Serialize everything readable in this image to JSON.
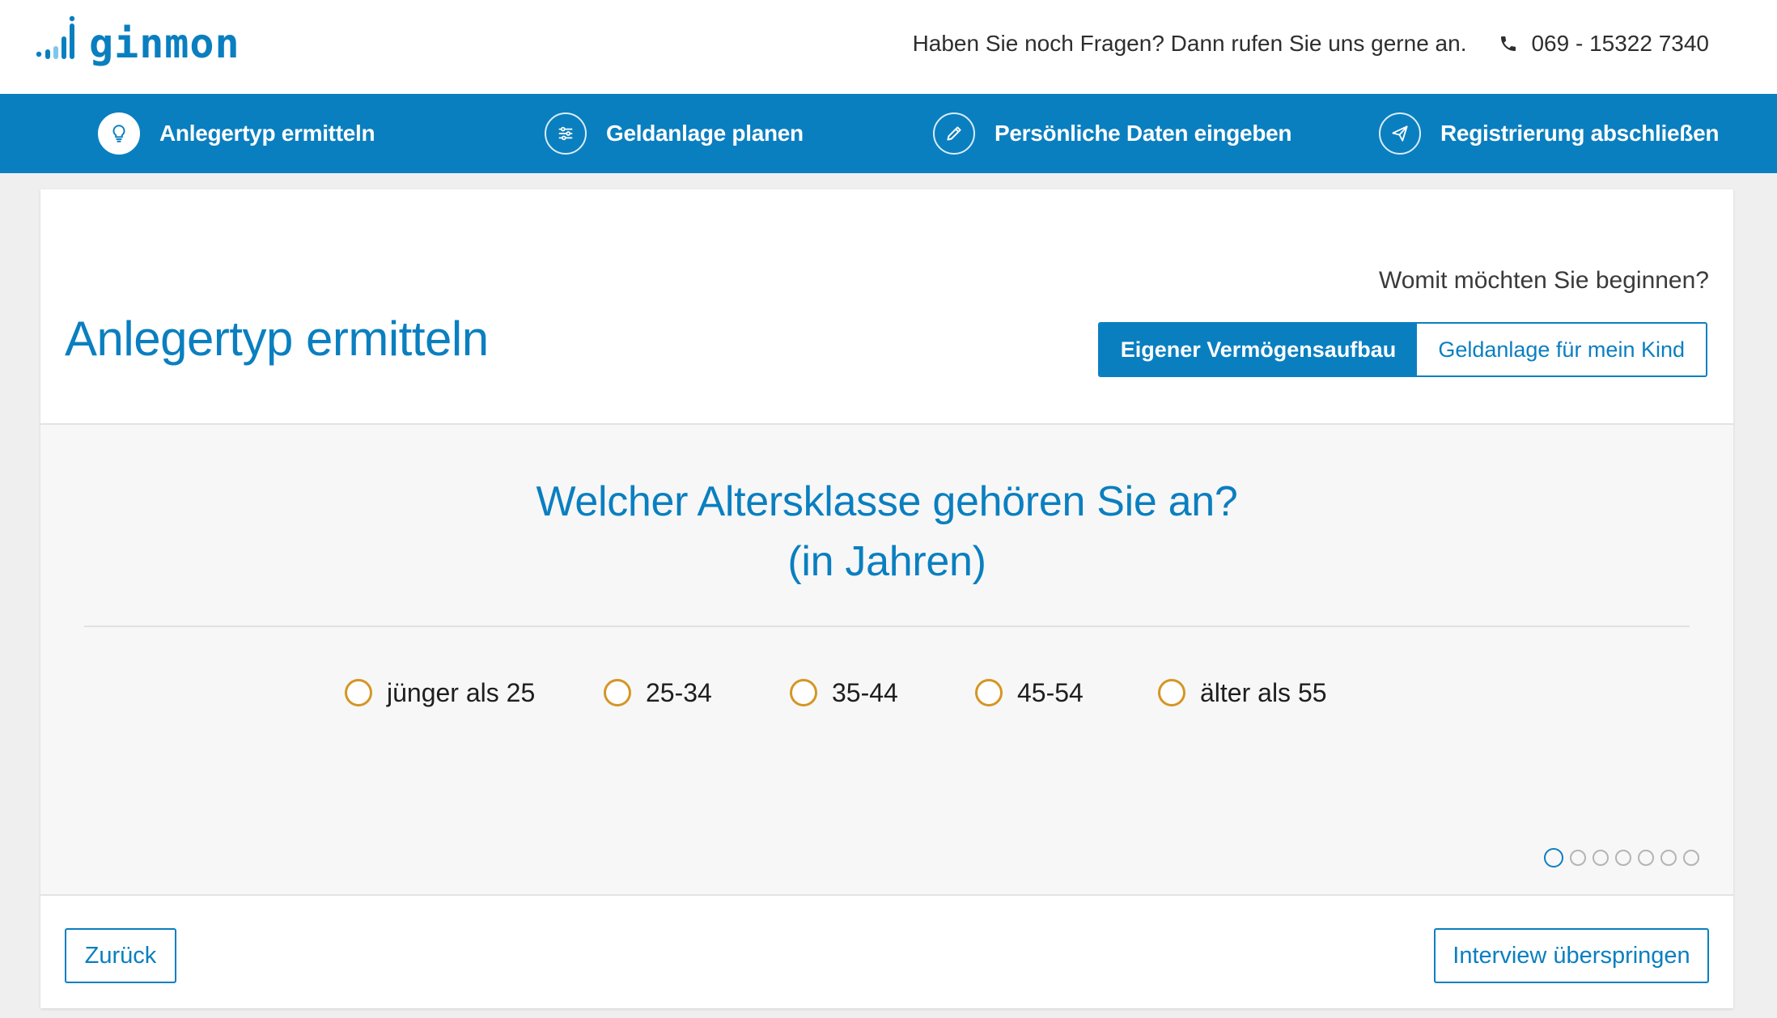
{
  "header": {
    "logo_text": "ginmon",
    "contact_text": "Haben Sie noch Fragen? Dann rufen Sie uns gerne an.",
    "phone_icon": "phone-icon",
    "phone_number": "069 - 15322 7340"
  },
  "steps": [
    {
      "label": "Anlegertyp ermitteln",
      "icon": "lightbulb-icon",
      "active": true
    },
    {
      "label": "Geldanlage planen",
      "icon": "sliders-icon",
      "active": false
    },
    {
      "label": "Persönliche Daten eingeben",
      "icon": "pencil-icon",
      "active": false
    },
    {
      "label": "Registrierung abschließen",
      "icon": "paper-plane-icon",
      "active": false
    }
  ],
  "page": {
    "title": "Anlegertyp ermitteln",
    "begin_question": "Womit möchten Sie beginnen?",
    "mode_options": [
      {
        "label": "Eigener Vermögensaufbau",
        "selected": true
      },
      {
        "label": "Geldanlage für mein Kind",
        "selected": false
      }
    ]
  },
  "question": {
    "line1": "Welcher Altersklasse gehören Sie an?",
    "line2": "(in Jahren)",
    "options": [
      "jünger als 25",
      "25-34",
      "35-44",
      "45-54",
      "älter als 55"
    ],
    "selected": null
  },
  "pagination": {
    "total": 7,
    "current": 1
  },
  "footer": {
    "back_label": "Zurück",
    "skip_label": "Interview überspringen"
  },
  "colors": {
    "brand_blue": "#0a7fc0",
    "radio_orange": "#d49624",
    "page_background": "#efefef"
  }
}
